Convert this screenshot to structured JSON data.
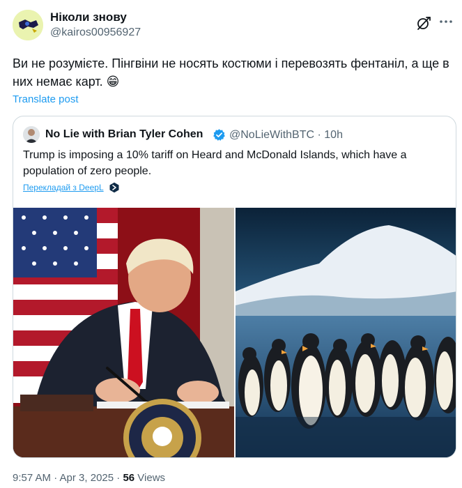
{
  "author": {
    "name": "Ніколи знову",
    "handle": "@kairos00956927"
  },
  "post": {
    "text": "Ви не розумієте. Пінгвіни не носять костюми і перевозять фентаніл, а ще в них немає карт. 😁",
    "translate_label": "Translate post"
  },
  "quote": {
    "name": "No Lie with Brian Tyler Cohen",
    "handle_time": "@NoLieWithBTC · 10h",
    "text": "Trump is imposing a 10% tariff on Heard and McDonald Islands, which have a population of zero people.",
    "deepl_label": "Перекладай з DeepL"
  },
  "meta": {
    "time": "9:57 AM · Apr 3, 2025 · ",
    "views_count": "56",
    "views_label": " Views"
  },
  "colors": {
    "accent": "#1d9bf0",
    "secondary_text": "#536471",
    "border": "#cfd9de"
  },
  "icons": {
    "grok": "grok-icon",
    "more": "more-icon",
    "verified": "verified-badge-icon",
    "deepl": "deepl-icon"
  }
}
